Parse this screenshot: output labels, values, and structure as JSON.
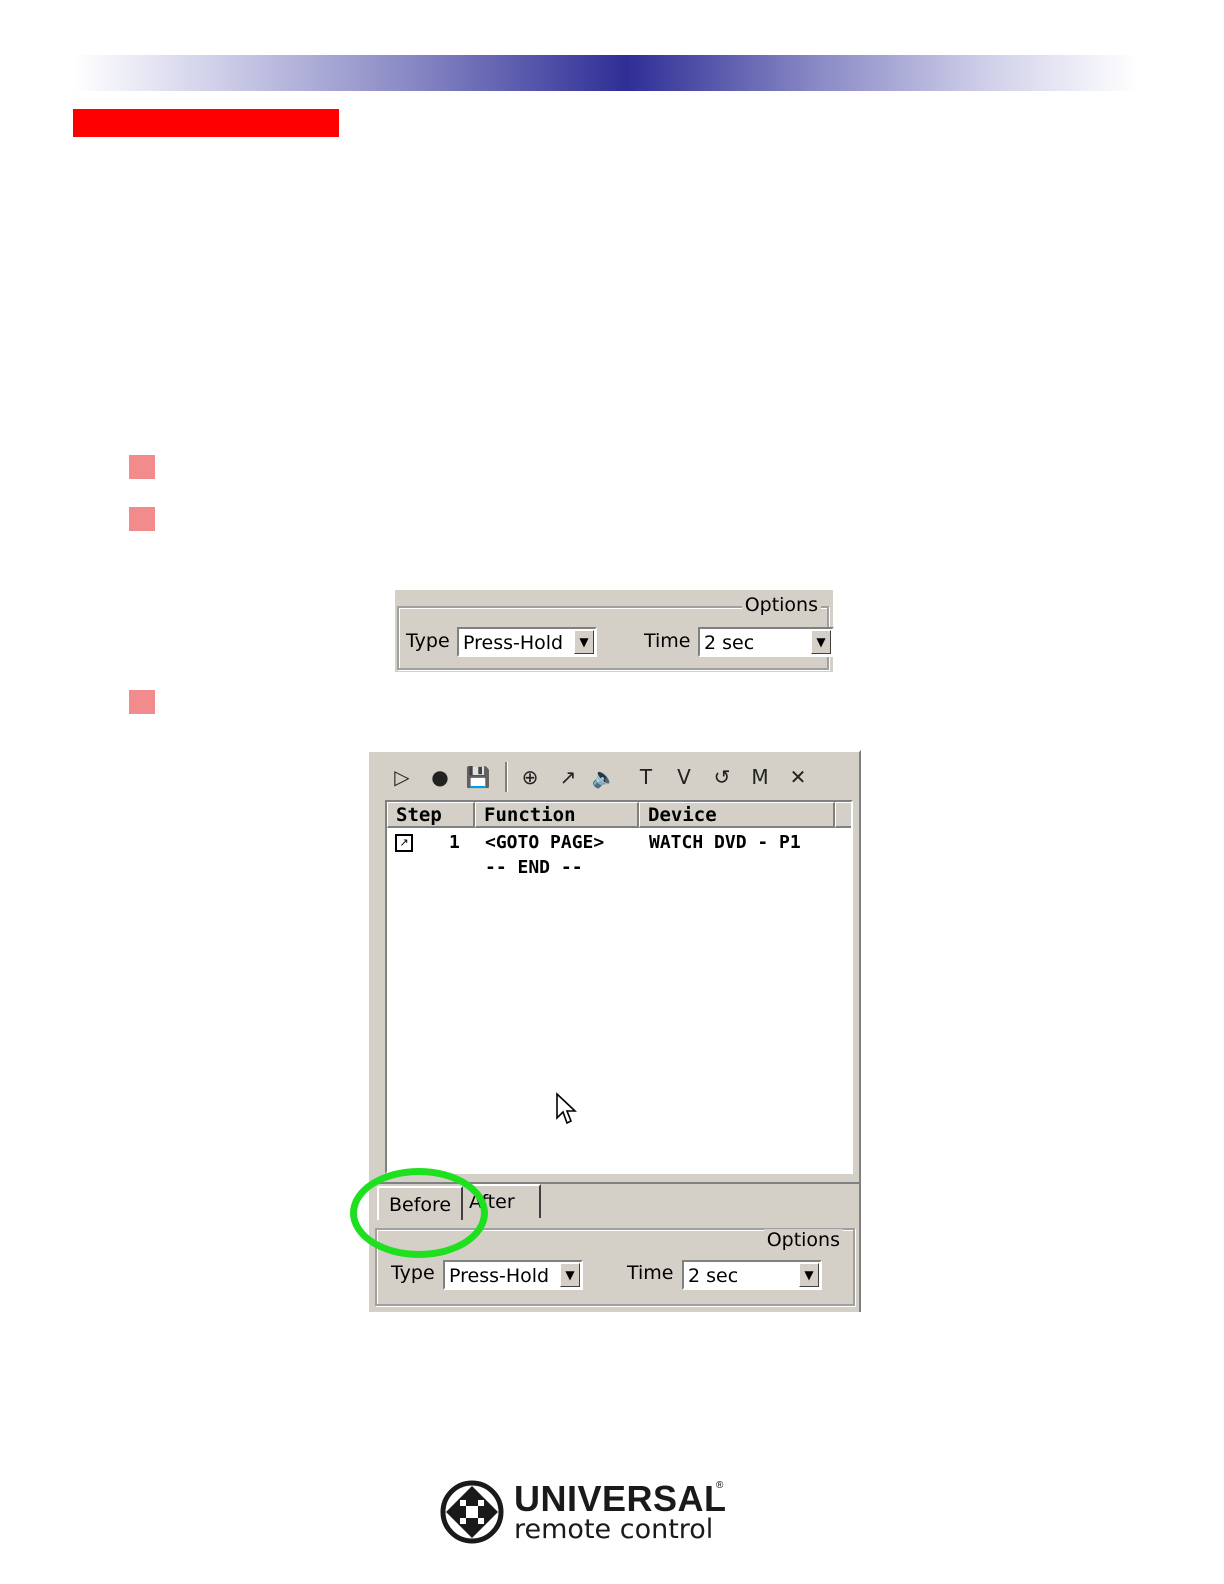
{
  "options_panel": {
    "title": "Options",
    "type_label": "Type",
    "type_value": "Press-Hold",
    "time_label": "Time",
    "time_value": "2 sec"
  },
  "macro_editor": {
    "toolbar": [
      {
        "icon": "play-icon",
        "glyph": "▷"
      },
      {
        "icon": "record-icon",
        "glyph": "●"
      },
      {
        "icon": "save-icon",
        "glyph": "💾"
      },
      {
        "icon": "add-delay-icon",
        "glyph": "⊕"
      },
      {
        "icon": "jump-icon",
        "glyph": "↗"
      },
      {
        "icon": "sound-icon",
        "glyph": "🔈"
      },
      {
        "icon": "text-icon",
        "glyph": "T"
      },
      {
        "icon": "variable-icon",
        "glyph": "V"
      },
      {
        "icon": "loop-icon",
        "glyph": "↺"
      },
      {
        "icon": "macro-icon",
        "glyph": "M"
      },
      {
        "icon": "delete-icon",
        "glyph": "✕"
      }
    ],
    "columns": [
      "Step",
      "Function",
      "Device"
    ],
    "rows": [
      {
        "step": "1",
        "function": "<GOTO PAGE>",
        "device": "WATCH DVD - P1"
      },
      {
        "step": "",
        "function": "-- END --",
        "device": ""
      }
    ],
    "tabs": [
      "Before",
      "After"
    ],
    "options": {
      "title": "Options",
      "type_label": "Type",
      "type_value": "Press-Hold",
      "time_label": "Time",
      "time_value": "2 sec"
    }
  },
  "logo": {
    "brand": "UNIVERSAL",
    "registered": "®",
    "tagline": "remote control"
  },
  "colors": {
    "header_gradient_center": "#2e2e96",
    "red_bar": "#ff0000",
    "bullet": "#f28b8b",
    "highlight_ring": "#1ee01e"
  }
}
